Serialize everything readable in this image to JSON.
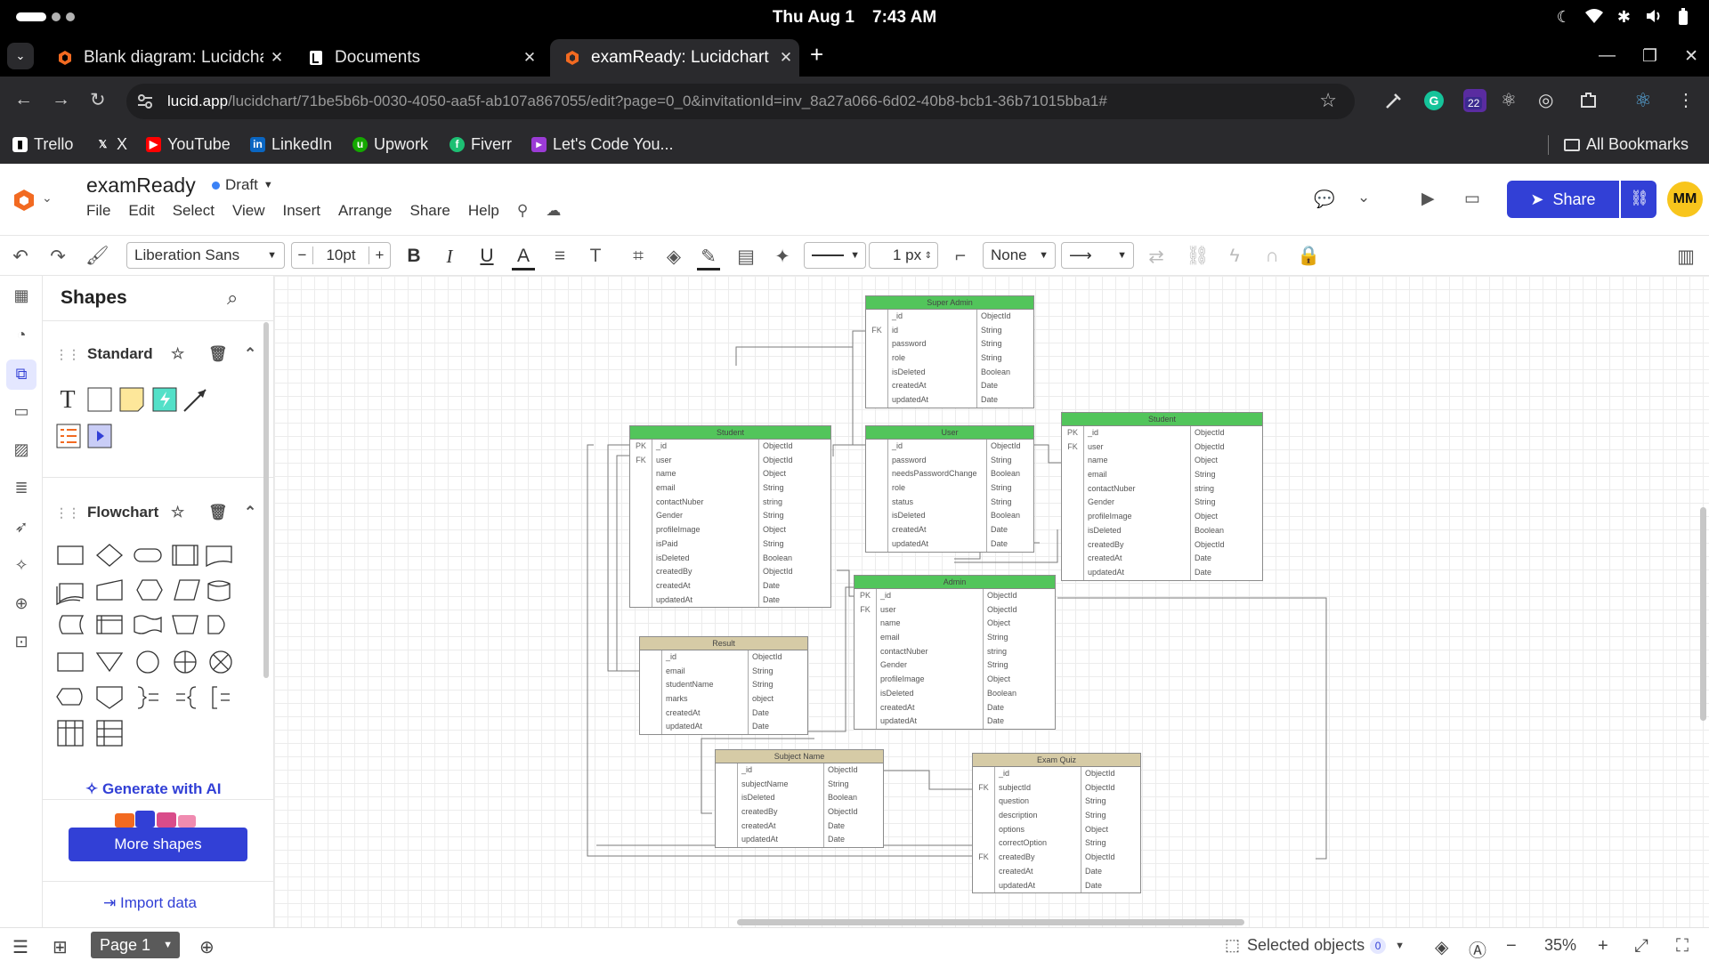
{
  "os": {
    "date": "Thu Aug 1",
    "time": "7:43 AM"
  },
  "browser": {
    "tabs": [
      {
        "title": "Blank diagram: Lucidchart",
        "icon": "lucid-icon"
      },
      {
        "title": "Documents",
        "icon": "lucid-doc-icon"
      },
      {
        "title": "examReady: Lucidchart",
        "icon": "lucid-icon"
      }
    ],
    "url_host": "lucid.app",
    "url_path": "/lucidchart/71be5b6b-0030-4050-aa5f-ab107a867055/edit?page=0_0&invitationId=inv_8a27a066-6d02-40b8-bcb1-36b71015bba1#",
    "extension_badge": "22",
    "bookmarks": [
      "Trello",
      "X",
      "YouTube",
      "LinkedIn",
      "Upwork",
      "Fiverr",
      "Let's Code You..."
    ],
    "all_bookmarks": "All Bookmarks"
  },
  "app": {
    "doc_title": "examReady",
    "status": "Draft",
    "menus": [
      "File",
      "Edit",
      "Select",
      "View",
      "Insert",
      "Arrange",
      "Share",
      "Help"
    ],
    "share_label": "Share",
    "avatar_initials": "MM",
    "accent": "#3240d6"
  },
  "toolbar": {
    "font": "Liberation Sans",
    "font_size": "10pt",
    "line_width": "1 px",
    "endpoint": "None"
  },
  "panel": {
    "title": "Shapes",
    "sections": [
      {
        "name": "Standard"
      },
      {
        "name": "Flowchart"
      }
    ],
    "generate_ai": "Generate with AI",
    "more_shapes": "More shapes",
    "import_data": "Import data"
  },
  "status": {
    "page": "Page 1",
    "selected_label": "Selected objects",
    "selected_count": "0",
    "zoom": "35%"
  },
  "entities": [
    {
      "name": "Super Admin",
      "rows": [
        [
          "",
          "_id",
          "ObjectId"
        ],
        [
          "FK",
          "id",
          "String"
        ],
        [
          "",
          "password",
          "String"
        ],
        [
          "",
          "role",
          "String"
        ],
        [
          "",
          "isDeleted",
          "Boolean"
        ],
        [
          "",
          "createdAt",
          "Date"
        ],
        [
          "",
          "updatedAt",
          "Date"
        ]
      ]
    },
    {
      "name": "Student",
      "rows": [
        [
          "PK",
          "_id",
          "ObjectId"
        ],
        [
          "FK",
          "user",
          "ObjectId"
        ],
        [
          "",
          "name",
          "Object"
        ],
        [
          "",
          "email",
          "String"
        ],
        [
          "",
          "contactNuber",
          "string"
        ],
        [
          "",
          "Gender",
          "String"
        ],
        [
          "",
          "profileImage",
          "Object"
        ],
        [
          "",
          "isPaid",
          "String"
        ],
        [
          "",
          "isDeleted",
          "Boolean"
        ],
        [
          "",
          "createdBy",
          "ObjectId"
        ],
        [
          "",
          "createdAt",
          "Date"
        ],
        [
          "",
          "updatedAt",
          "Date"
        ]
      ]
    },
    {
      "name": "User",
      "rows": [
        [
          "",
          "_id",
          "ObjectId"
        ],
        [
          "",
          "password",
          "String"
        ],
        [
          "",
          "needsPasswordChange",
          "Boolean"
        ],
        [
          "",
          "role",
          "String"
        ],
        [
          "",
          "status",
          "String"
        ],
        [
          "",
          "isDeleted",
          "Boolean"
        ],
        [
          "",
          "createdAt",
          "Date"
        ],
        [
          "",
          "updatedAt",
          "Date"
        ]
      ]
    },
    {
      "name": "Student",
      "rows": [
        [
          "PK",
          "_id",
          "ObjectId"
        ],
        [
          "FK",
          "user",
          "ObjectId"
        ],
        [
          "",
          "name",
          "Object"
        ],
        [
          "",
          "email",
          "String"
        ],
        [
          "",
          "contactNuber",
          "string"
        ],
        [
          "",
          "Gender",
          "String"
        ],
        [
          "",
          "profileImage",
          "Object"
        ],
        [
          "",
          "isDeleted",
          "Boolean"
        ],
        [
          "",
          "createdBy",
          "ObjectId"
        ],
        [
          "",
          "createdAt",
          "Date"
        ],
        [
          "",
          "updatedAt",
          "Date"
        ]
      ]
    },
    {
      "name": "Admin",
      "rows": [
        [
          "PK",
          "_id",
          "ObjectId"
        ],
        [
          "FK",
          "user",
          "ObjectId"
        ],
        [
          "",
          "name",
          "Object"
        ],
        [
          "",
          "email",
          "String"
        ],
        [
          "",
          "contactNuber",
          "string"
        ],
        [
          "",
          "Gender",
          "String"
        ],
        [
          "",
          "profileImage",
          "Object"
        ],
        [
          "",
          "isDeleted",
          "Boolean"
        ],
        [
          "",
          "createdAt",
          "Date"
        ],
        [
          "",
          "updatedAt",
          "Date"
        ]
      ]
    },
    {
      "name": "Result",
      "rows": [
        [
          "",
          "_id",
          "ObjectId"
        ],
        [
          "",
          "email",
          "String"
        ],
        [
          "",
          "studentName",
          "String"
        ],
        [
          "",
          "marks",
          "object"
        ],
        [
          "",
          "createdAt",
          "Date"
        ],
        [
          "",
          "updatedAt",
          "Date"
        ]
      ]
    },
    {
      "name": "Subject Name",
      "rows": [
        [
          "",
          "_id",
          "ObjectId"
        ],
        [
          "",
          "subjectName",
          "String"
        ],
        [
          "",
          "isDeleted",
          "Boolean"
        ],
        [
          "",
          "createdBy",
          "ObjectId"
        ],
        [
          "",
          "createdAt",
          "Date"
        ],
        [
          "",
          "updatedAt",
          "Date"
        ]
      ]
    },
    {
      "name": "Exam Quiz",
      "rows": [
        [
          "",
          "_id",
          "ObjectId"
        ],
        [
          "FK",
          "subjectId",
          "ObjectId"
        ],
        [
          "",
          "question",
          "String"
        ],
        [
          "",
          "description",
          "String"
        ],
        [
          "",
          "options",
          "Object"
        ],
        [
          "",
          "correctOption",
          "String"
        ],
        [
          "FK",
          "createdBy",
          "ObjectId"
        ],
        [
          "",
          "createdAt",
          "Date"
        ],
        [
          "",
          "updatedAt",
          "Date"
        ]
      ]
    }
  ]
}
